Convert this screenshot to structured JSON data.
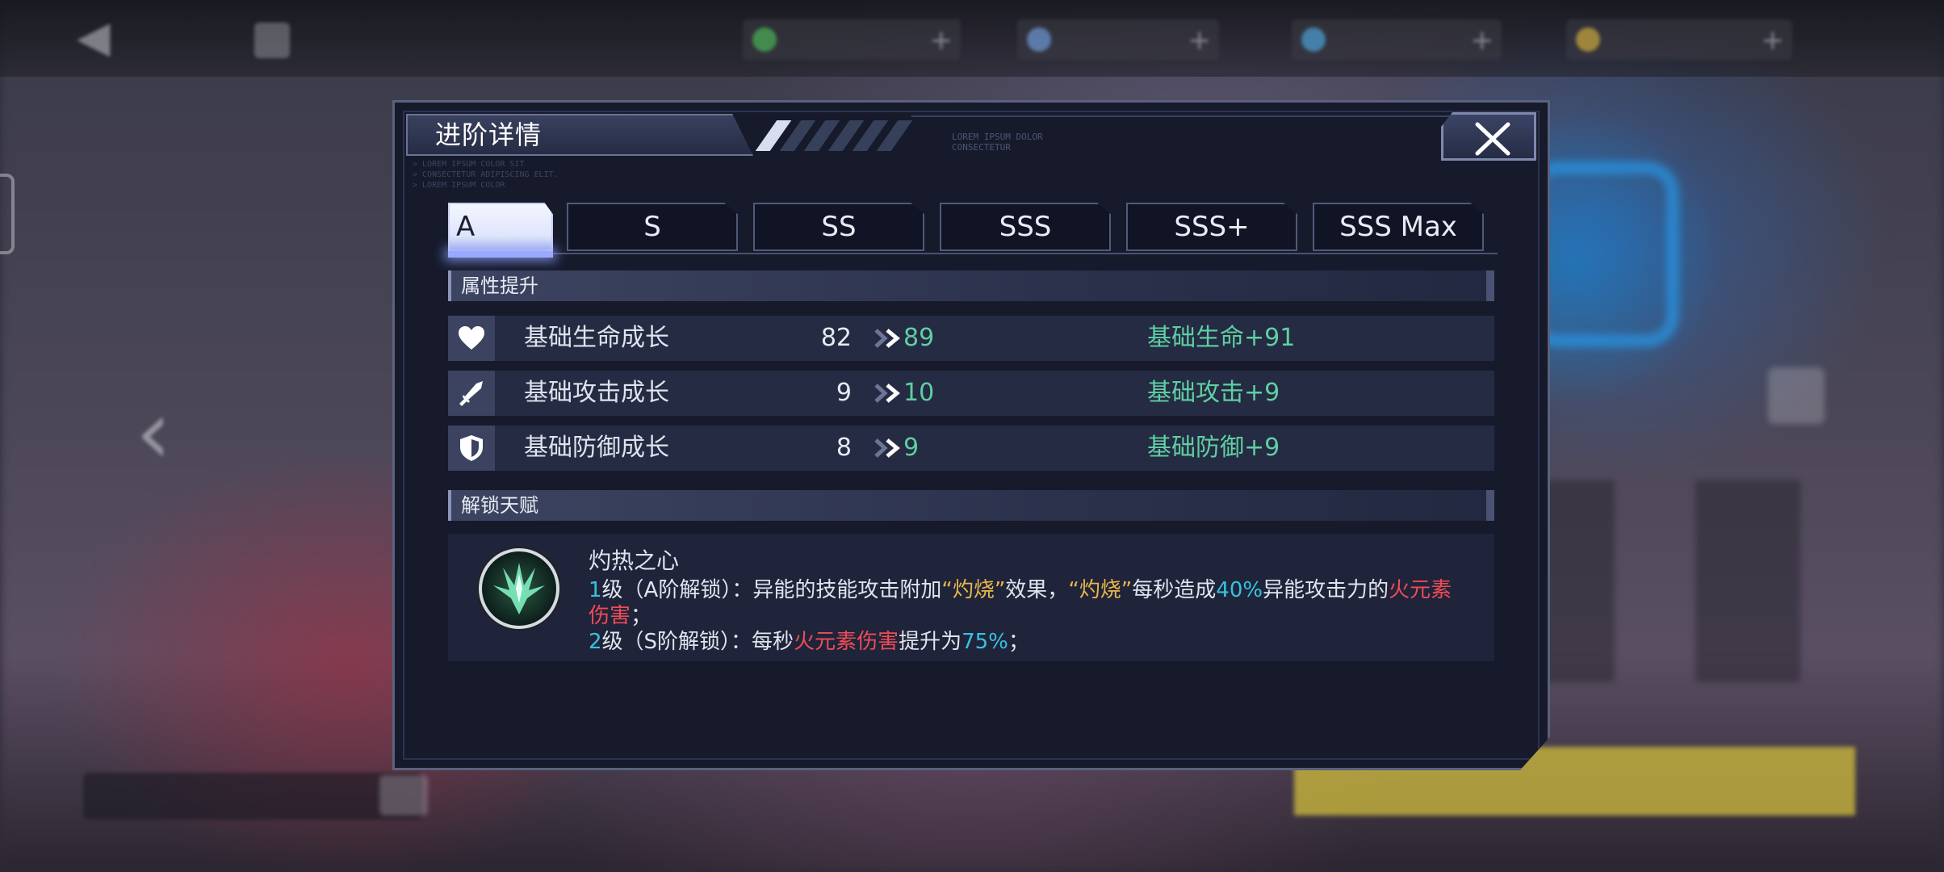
{
  "dialog": {
    "title": "进阶详情",
    "lorem_right": [
      "LOREM IPSUM DOLOR",
      "CONSECTETUR"
    ],
    "lorem_left": [
      "> LOREM IPSUM COLOR SIT",
      "> CONSECTETUR ADIPISCING ELIT.",
      "> LOREM IPSUM COLOR"
    ]
  },
  "tabs": [
    {
      "label": "A",
      "active": true
    },
    {
      "label": "S",
      "active": false
    },
    {
      "label": "SS",
      "active": false
    },
    {
      "label": "SSS",
      "active": false
    },
    {
      "label": "SSS+",
      "active": false
    },
    {
      "label": "SSS Max",
      "active": false
    }
  ],
  "attributes": {
    "header": "属性提升",
    "rows": [
      {
        "icon": "heart-icon",
        "name": "基础生命成长",
        "old": "82",
        "new": "89",
        "bonus": "基础生命+91"
      },
      {
        "icon": "sword-icon",
        "name": "基础攻击成长",
        "old": "9",
        "new": "10",
        "bonus": "基础攻击+9"
      },
      {
        "icon": "shield-icon",
        "name": "基础防御成长",
        "old": "8",
        "new": "9",
        "bonus": "基础防御+9"
      }
    ]
  },
  "talent": {
    "header": "解锁天赋",
    "name": "灼热之心",
    "line1": {
      "level": "1",
      "t1": "级（A阶解锁）：异能的技能攻击附加",
      "kw1": "“灼烧”",
      "t2": "效果，",
      "kw2": "“灼烧”",
      "t3": "每秒造成",
      "pct": "40%",
      "t4": "异能攻击力的",
      "dmg": "火元素伤害",
      "t5": "；"
    },
    "line2": {
      "level": "2",
      "t1": "级（S阶解锁）：每秒",
      "dmg": "火元素伤害",
      "t2": "提升为",
      "pct": "75%",
      "t3": "；"
    }
  },
  "colors": {
    "accent_green": "#5fcfa3",
    "accent_cyan": "#35c3e0",
    "keyword_gold": "#e9b54a",
    "damage_red": "#ef4c56",
    "panel_bg": "#161a2b"
  }
}
